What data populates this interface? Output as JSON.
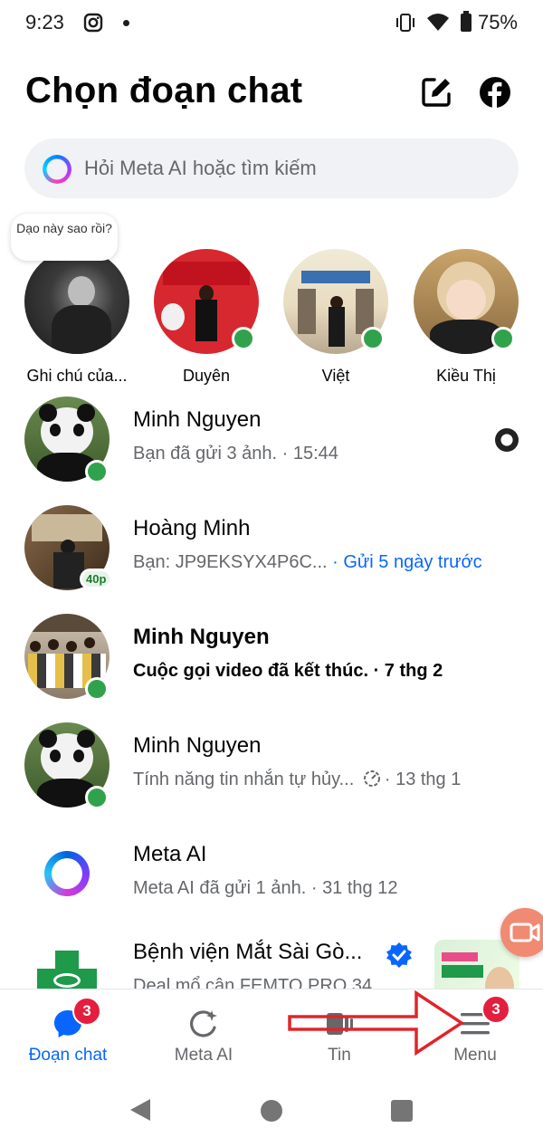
{
  "status_bar": {
    "time": "9:23",
    "battery": "75%"
  },
  "header": {
    "title": "Chọn đoạn chat"
  },
  "search": {
    "placeholder": "Hỏi Meta AI hoặc tìm kiếm"
  },
  "note": {
    "text": "Dạo này sao rồi?"
  },
  "stories": [
    {
      "name": "Ghi chú của..."
    },
    {
      "name": "Duyên"
    },
    {
      "name": "Việt"
    },
    {
      "name": "Kiều Thị"
    }
  ],
  "chats": [
    {
      "name": "Minh Nguyen",
      "message": "Bạn đã gửi 3 ảnh. · 15:44"
    },
    {
      "name": "Hoàng Minh",
      "message": "Bạn: JP9EKSYX4P6C...",
      "time": " · Gửi 5 ngày trước",
      "badge": "40p"
    },
    {
      "name": "Minh Nguyen",
      "message": "Cuộc gọi video đã kết thúc. · 7 thg 2"
    },
    {
      "name": "Minh Nguyen",
      "message": "Tính năng tin nhắn tự hủy...",
      "time": "· 13 thg 1"
    },
    {
      "name": "Meta AI",
      "message": "Meta AI đã gửi 1 ảnh. · 31 thg 12"
    },
    {
      "name": "Bệnh viện Mắt Sài Gò...",
      "message": "Deal mổ cận FEMTO PRO 34"
    }
  ],
  "nav": {
    "items": [
      {
        "label": "Đoạn chat",
        "badge": "3"
      },
      {
        "label": "Meta AI"
      },
      {
        "label": "Tin"
      },
      {
        "label": "Menu",
        "badge": "3"
      }
    ]
  },
  "colors": {
    "accent": "#0866ff",
    "online": "#31a24c",
    "badge": "#e41e3f",
    "annotation_arrow": "#e0252a"
  }
}
